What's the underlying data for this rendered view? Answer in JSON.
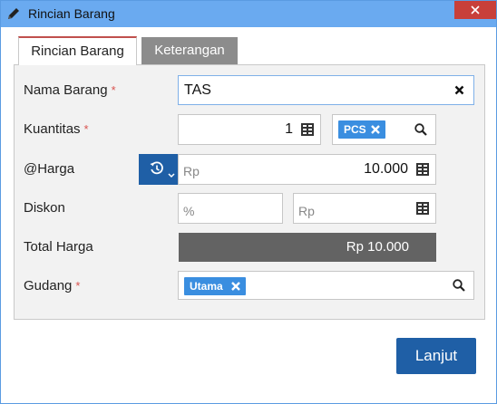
{
  "window": {
    "title": "Rincian Barang"
  },
  "tabs": [
    {
      "label": "Rincian Barang",
      "active": true
    },
    {
      "label": "Keterangan",
      "active": false
    }
  ],
  "form": {
    "nama_barang": {
      "label": "Nama Barang",
      "required_mark": "*",
      "value": "TAS"
    },
    "kuantitas": {
      "label": "Kuantitas",
      "required_mark": "*",
      "value": "1",
      "unit_tag": "PCS"
    },
    "harga": {
      "label": "@Harga",
      "prefix": "Rp",
      "value": "10.000"
    },
    "diskon": {
      "label": "Diskon",
      "percent_placeholder": "%",
      "amount_placeholder": "Rp"
    },
    "total_harga": {
      "label": "Total Harga",
      "value": "Rp 10.000"
    },
    "gudang": {
      "label": "Gudang",
      "required_mark": "*",
      "tag": "Utama"
    }
  },
  "actions": {
    "next_label": "Lanjut"
  },
  "colors": {
    "primary": "#1f5fa6",
    "tag_blue": "#3a8ee0",
    "titlebar": "#6aaaf0",
    "close_red": "#c8403a",
    "required": "#d9534f"
  }
}
